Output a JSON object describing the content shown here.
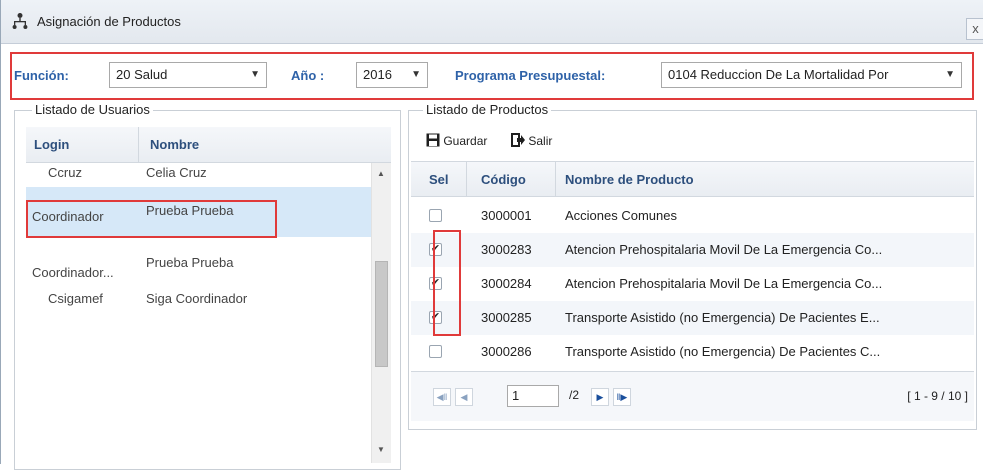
{
  "window": {
    "title": "Asignación de Productos",
    "close_label": "x"
  },
  "filters": {
    "funcion_label": "Función:",
    "funcion_value": "20 Salud",
    "anio_label": "Año :",
    "anio_value": "2016",
    "programa_label": "Programa Presupuestal:",
    "programa_value": "0104 Reduccion De La Mortalidad Por"
  },
  "users_panel": {
    "legend": "Listado de Usuarios",
    "columns": [
      "Login",
      "Nombre"
    ],
    "rows": [
      {
        "login": "Ccruz",
        "nombre": "Celia Cruz"
      },
      {
        "login": "Coordinador",
        "nombre": "Prueba Prueba"
      },
      {
        "login": "Coordinador...",
        "nombre": "Prueba Prueba"
      },
      {
        "login": "Csigamef",
        "nombre": "Siga Coordinador"
      }
    ]
  },
  "products_panel": {
    "legend": "Listado de Productos",
    "toolbar": {
      "save_label": "Guardar",
      "exit_label": "Salir"
    },
    "columns": [
      "Sel",
      "Código",
      "Nombre de Producto"
    ],
    "rows": [
      {
        "checked": false,
        "codigo": "3000001",
        "nombre": "Acciones Comunes"
      },
      {
        "checked": true,
        "codigo": "3000283",
        "nombre": "Atencion Prehospitalaria Movil De La Emergencia Co..."
      },
      {
        "checked": true,
        "codigo": "3000284",
        "nombre": "Atencion Prehospitalaria Movil De La Emergencia Co..."
      },
      {
        "checked": true,
        "codigo": "3000285",
        "nombre": "Transporte Asistido (no Emergencia) De Pacientes E..."
      },
      {
        "checked": false,
        "codigo": "3000286",
        "nombre": "Transporte Asistido (no Emergencia) De Pacientes C..."
      }
    ],
    "pager": {
      "current_page": "1",
      "total_pages": "/2",
      "summary": "[ 1 - 9 / 10 ]"
    }
  },
  "colors": {
    "accent_red": "#e03a3a",
    "label_blue": "#2e62a8",
    "selected_row": "#d6e8f8"
  }
}
